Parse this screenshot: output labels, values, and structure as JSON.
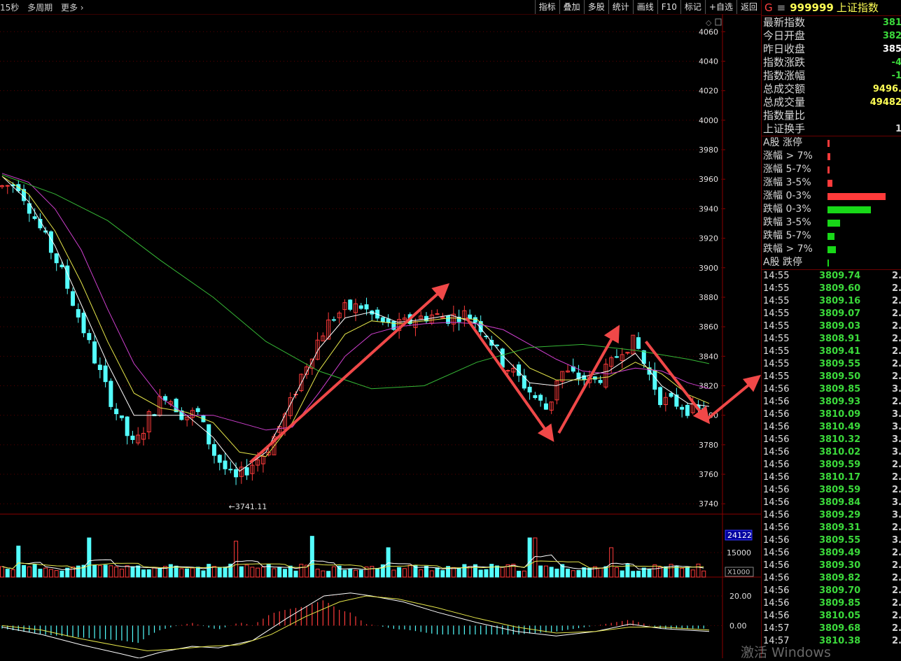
{
  "toolbar": {
    "left_items": [
      "15秒",
      "多周期",
      "更多 ›"
    ],
    "right_buttons": [
      "指标",
      "叠加",
      "多股",
      "统计",
      "画线",
      "F10",
      "标记",
      "+自选",
      "返回"
    ]
  },
  "chart_data": [
    {
      "type": "candlestick",
      "name": "price",
      "y_ticks": [
        4060,
        4040,
        4020,
        4000,
        3980,
        3960,
        3940,
        3920,
        3900,
        3880,
        3860,
        3840,
        3820,
        3800,
        3780,
        3760,
        3740
      ],
      "ylim": [
        3733,
        4072
      ],
      "low_marker": "←3741.11",
      "low_value": 3741.11,
      "candles_count": 130,
      "close_path": [
        [
          0,
          3955
        ],
        [
          6,
          3957
        ],
        [
          14,
          3928
        ],
        [
          22,
          3900
        ],
        [
          30,
          3862
        ],
        [
          38,
          3824
        ],
        [
          45,
          3795
        ],
        [
          50,
          3778
        ],
        [
          56,
          3800
        ],
        [
          62,
          3815
        ],
        [
          69,
          3799
        ],
        [
          74,
          3802
        ],
        [
          80,
          3775
        ],
        [
          88,
          3755
        ],
        [
          94,
          3766
        ],
        [
          100,
          3775
        ],
        [
          108,
          3802
        ],
        [
          114,
          3830
        ],
        [
          120,
          3852
        ],
        [
          125,
          3866
        ],
        [
          130,
          3872
        ],
        [
          136,
          3874
        ],
        [
          142,
          3865
        ],
        [
          148,
          3859
        ],
        [
          155,
          3864
        ],
        [
          162,
          3868
        ],
        [
          170,
          3866
        ],
        [
          174,
          3869
        ],
        [
          178,
          3867
        ],
        [
          184,
          3855
        ],
        [
          190,
          3835
        ],
        [
          196,
          3825
        ],
        [
          202,
          3812
        ],
        [
          207,
          3803
        ],
        [
          211,
          3830
        ],
        [
          218,
          3826
        ],
        [
          225,
          3823
        ],
        [
          230,
          3832
        ],
        [
          235,
          3846
        ],
        [
          240,
          3850
        ],
        [
          244,
          3832
        ],
        [
          250,
          3810
        ],
        [
          256,
          3808
        ],
        [
          263,
          3802
        ],
        [
          268,
          3803
        ]
      ],
      "ma_lines": [
        {
          "name": "MA-white",
          "color": "#ffffff",
          "points": [
            [
              0,
              3962
            ],
            [
              10,
              3945
            ],
            [
              20,
              3915
            ],
            [
              30,
              3875
            ],
            [
              40,
              3835
            ],
            [
              50,
              3800
            ],
            [
              60,
              3800
            ],
            [
              70,
              3800
            ],
            [
              80,
              3785
            ],
            [
              90,
              3762
            ],
            [
              100,
              3775
            ],
            [
              110,
              3810
            ],
            [
              120,
              3845
            ],
            [
              130,
              3866
            ],
            [
              140,
              3870
            ],
            [
              150,
              3863
            ],
            [
              160,
              3865
            ],
            [
              170,
              3868
            ],
            [
              180,
              3862
            ],
            [
              190,
              3840
            ],
            [
              200,
              3822
            ],
            [
              210,
              3820
            ],
            [
              220,
              3826
            ],
            [
              230,
              3830
            ],
            [
              240,
              3842
            ],
            [
              250,
              3820
            ],
            [
              260,
              3808
            ],
            [
              268,
              3806
            ]
          ]
        },
        {
          "name": "MA-yellow",
          "color": "#e6e64a",
          "points": [
            [
              0,
              3962
            ],
            [
              10,
              3950
            ],
            [
              20,
              3925
            ],
            [
              30,
              3890
            ],
            [
              40,
              3850
            ],
            [
              50,
              3815
            ],
            [
              60,
              3805
            ],
            [
              70,
              3802
            ],
            [
              80,
              3795
            ],
            [
              90,
              3775
            ],
            [
              100,
              3772
            ],
            [
              110,
              3795
            ],
            [
              120,
              3830
            ],
            [
              130,
              3855
            ],
            [
              140,
              3864
            ],
            [
              150,
              3862
            ],
            [
              160,
              3864
            ],
            [
              170,
              3866
            ],
            [
              180,
              3865
            ],
            [
              190,
              3850
            ],
            [
              200,
              3832
            ],
            [
              210,
              3824
            ],
            [
              220,
              3824
            ],
            [
              230,
              3826
            ],
            [
              240,
              3836
            ],
            [
              250,
              3828
            ],
            [
              260,
              3814
            ],
            [
              268,
              3808
            ]
          ]
        },
        {
          "name": "MA-magenta",
          "color": "#d040d0",
          "points": [
            [
              0,
              3964
            ],
            [
              10,
              3958
            ],
            [
              20,
              3940
            ],
            [
              30,
              3912
            ],
            [
              40,
              3872
            ],
            [
              50,
              3835
            ],
            [
              60,
              3812
            ],
            [
              70,
              3800
            ],
            [
              80,
              3800
            ],
            [
              90,
              3795
            ],
            [
              100,
              3790
            ],
            [
              110,
              3792
            ],
            [
              120,
              3815
            ],
            [
              130,
              3840
            ],
            [
              140,
              3855
            ],
            [
              150,
              3860
            ],
            [
              160,
              3862
            ],
            [
              170,
              3863
            ],
            [
              180,
              3862
            ],
            [
              190,
              3858
            ],
            [
              200,
              3848
            ],
            [
              210,
              3838
            ],
            [
              220,
              3830
            ],
            [
              230,
              3828
            ],
            [
              240,
              3832
            ],
            [
              250,
              3830
            ],
            [
              260,
              3822
            ],
            [
              268,
              3818
            ]
          ]
        },
        {
          "name": "MA-green",
          "color": "#36b836",
          "points": [
            [
              0,
              3963
            ],
            [
              20,
              3950
            ],
            [
              40,
              3932
            ],
            [
              60,
              3905
            ],
            [
              80,
              3880
            ],
            [
              100,
              3850
            ],
            [
              120,
              3830
            ],
            [
              140,
              3818
            ],
            [
              160,
              3820
            ],
            [
              180,
              3836
            ],
            [
              200,
              3846
            ],
            [
              220,
              3848
            ],
            [
              240,
              3844
            ],
            [
              260,
              3838
            ],
            [
              268,
              3835
            ]
          ]
        }
      ],
      "trend_arrows": [
        {
          "from": [
            94,
            3768
          ],
          "to": [
            168,
            3887
          ]
        },
        {
          "from": [
            176,
            3866
          ],
          "to": [
            208,
            3785
          ]
        },
        {
          "from": [
            211,
            3788
          ],
          "to": [
            233,
            3858
          ]
        },
        {
          "from": [
            244,
            3850
          ],
          "to": [
            267,
            3797
          ]
        },
        {
          "from": [
            267,
            3797
          ],
          "to": [
            286,
            3825
          ]
        }
      ]
    },
    {
      "type": "bar",
      "name": "volume",
      "y_ticks": [
        15000
      ],
      "ylim": [
        0,
        30000
      ],
      "current_value_box": "24122",
      "unit_box": "X1000",
      "peaks": [
        [
          6,
          19000
        ],
        [
          33,
          24000
        ],
        [
          89,
          22000
        ],
        [
          118,
          25000
        ],
        [
          146,
          18000
        ],
        [
          201,
          24000
        ],
        [
          231,
          18000
        ]
      ],
      "ma_lines": [
        {
          "name": "VOL-MA-white",
          "color": "#ffffff"
        },
        {
          "name": "VOL-MA-yellow",
          "color": "#e6e64a"
        }
      ]
    },
    {
      "type": "macd",
      "name": "macd",
      "y_ticks": [
        "20.00",
        "0.00"
      ],
      "ylim": [
        -22,
        28
      ],
      "dif_points": [
        [
          0,
          -1
        ],
        [
          15,
          -6
        ],
        [
          30,
          -13
        ],
        [
          45,
          -19
        ],
        [
          52,
          -22
        ],
        [
          60,
          -18
        ],
        [
          72,
          -14
        ],
        [
          82,
          -15
        ],
        [
          95,
          -10
        ],
        [
          108,
          5
        ],
        [
          122,
          20
        ],
        [
          132,
          22
        ],
        [
          140,
          20
        ],
        [
          152,
          16
        ],
        [
          165,
          9
        ],
        [
          180,
          2
        ],
        [
          195,
          -4
        ],
        [
          210,
          -7
        ],
        [
          225,
          -4
        ],
        [
          238,
          1
        ],
        [
          250,
          -2
        ],
        [
          268,
          -4
        ]
      ],
      "dea_points": [
        [
          0,
          0
        ],
        [
          15,
          -3
        ],
        [
          30,
          -9
        ],
        [
          45,
          -14
        ],
        [
          55,
          -17
        ],
        [
          65,
          -16
        ],
        [
          78,
          -14
        ],
        [
          90,
          -13
        ],
        [
          102,
          -6
        ],
        [
          115,
          6
        ],
        [
          128,
          16
        ],
        [
          138,
          20
        ],
        [
          150,
          18
        ],
        [
          165,
          12
        ],
        [
          180,
          5
        ],
        [
          195,
          -1
        ],
        [
          210,
          -5
        ],
        [
          225,
          -4
        ],
        [
          238,
          -1
        ],
        [
          250,
          -1
        ],
        [
          268,
          -3
        ]
      ]
    }
  ],
  "sidebar": {
    "title_g": "G",
    "title_code": "999999",
    "title_name": "上证指数",
    "stats": [
      {
        "label": "最新指数",
        "value": "381",
        "color": "#3bd93b"
      },
      {
        "label": "今日开盘",
        "value": "382",
        "color": "#3bd93b"
      },
      {
        "label": "昨日收盘",
        "value": "385",
        "color": "#ffffff"
      },
      {
        "label": "指数涨跌",
        "value": "-4",
        "color": "#3bd93b"
      },
      {
        "label": "指数涨幅",
        "value": "-1",
        "color": "#3bd93b"
      },
      {
        "label": "总成交额",
        "value": "9496.",
        "color": "#ffff55"
      },
      {
        "label": "总成交量",
        "value": "49482",
        "color": "#ffff55"
      },
      {
        "label": "指数量比",
        "value": "",
        "color": "#d8d8d8"
      },
      {
        "label": "上证换手",
        "value": "1",
        "color": "#d8d8d8"
      }
    ],
    "distribution": [
      {
        "label": "A股 涨停",
        "level": 0.03,
        "color": "#ff3a3a"
      },
      {
        "label": "涨幅 > 7%",
        "level": 0.04,
        "color": "#ff3a3a"
      },
      {
        "label": "涨幅 5-7%",
        "level": 0.03,
        "color": "#ff3a3a"
      },
      {
        "label": "涨幅 3-5%",
        "level": 0.07,
        "color": "#ff3a3a"
      },
      {
        "label": "涨幅 0-3%",
        "level": 0.8,
        "color": "#ff3a3a"
      },
      {
        "label": "跌幅 0-3%",
        "level": 0.6,
        "color": "#18d818"
      },
      {
        "label": "跌幅 3-5%",
        "level": 0.17,
        "color": "#18d818"
      },
      {
        "label": "跌幅 5-7%",
        "level": 0.1,
        "color": "#18d818"
      },
      {
        "label": "跌幅 > 7%",
        "level": 0.12,
        "color": "#18d818"
      },
      {
        "label": "A股 跌停",
        "level": 0.01,
        "color": "#18d818"
      }
    ],
    "ticks": [
      {
        "time": "14:55",
        "price": "3809.74",
        "vol": "2."
      },
      {
        "time": "14:55",
        "price": "3809.60",
        "vol": "2."
      },
      {
        "time": "14:55",
        "price": "3809.16",
        "vol": "2."
      },
      {
        "time": "14:55",
        "price": "3809.07",
        "vol": "2."
      },
      {
        "time": "14:55",
        "price": "3809.03",
        "vol": "2."
      },
      {
        "time": "14:55",
        "price": "3808.91",
        "vol": "2."
      },
      {
        "time": "14:55",
        "price": "3809.41",
        "vol": "2."
      },
      {
        "time": "14:55",
        "price": "3809.55",
        "vol": "2."
      },
      {
        "time": "14:55",
        "price": "3809.50",
        "vol": "2."
      },
      {
        "time": "14:56",
        "price": "3809.85",
        "vol": "3."
      },
      {
        "time": "14:56",
        "price": "3809.93",
        "vol": "2."
      },
      {
        "time": "14:56",
        "price": "3810.09",
        "vol": "3."
      },
      {
        "time": "14:56",
        "price": "3810.49",
        "vol": "3."
      },
      {
        "time": "14:56",
        "price": "3810.32",
        "vol": "3."
      },
      {
        "time": "14:56",
        "price": "3810.02",
        "vol": "3."
      },
      {
        "time": "14:56",
        "price": "3809.59",
        "vol": "2."
      },
      {
        "time": "14:56",
        "price": "3810.17",
        "vol": "2."
      },
      {
        "time": "14:56",
        "price": "3809.59",
        "vol": "2."
      },
      {
        "time": "14:56",
        "price": "3809.84",
        "vol": "3."
      },
      {
        "time": "14:56",
        "price": "3809.29",
        "vol": "3."
      },
      {
        "time": "14:56",
        "price": "3809.31",
        "vol": "2."
      },
      {
        "time": "14:56",
        "price": "3809.55",
        "vol": "3."
      },
      {
        "time": "14:56",
        "price": "3809.49",
        "vol": "2."
      },
      {
        "time": "14:56",
        "price": "3809.30",
        "vol": "2."
      },
      {
        "time": "14:56",
        "price": "3809.82",
        "vol": "2."
      },
      {
        "time": "14:56",
        "price": "3809.70",
        "vol": "2."
      },
      {
        "time": "14:56",
        "price": "3809.85",
        "vol": "2."
      },
      {
        "time": "14:56",
        "price": "3810.05",
        "vol": "2."
      },
      {
        "time": "14:57",
        "price": "3809.68",
        "vol": "2."
      },
      {
        "time": "14:57",
        "price": "3810.38",
        "vol": "2."
      }
    ]
  },
  "watermark": "激活 Windows",
  "colors": {
    "up": "#ff3b3b",
    "down": "#54ffff",
    "axis": "#8b0000",
    "arrow": "#f04848",
    "tick_text": "#e0e0e0"
  }
}
